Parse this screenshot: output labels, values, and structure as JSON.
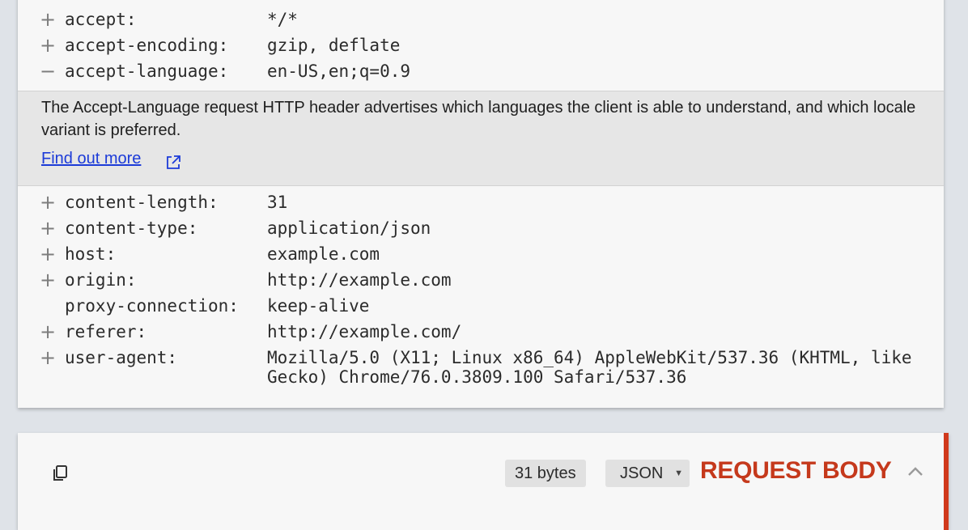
{
  "headers_top": [
    {
      "toggle": "+",
      "name": "accept:",
      "value": "*/*"
    },
    {
      "toggle": "+",
      "name": "accept-encoding:",
      "value": "gzip, deflate"
    },
    {
      "toggle": "−",
      "name": "accept-language:",
      "value": "en-US,en;q=0.9"
    }
  ],
  "doc": {
    "description": "The Accept-Language request HTTP header advertises which languages the client is able to understand, and which locale variant is preferred.",
    "link_label": "Find out more"
  },
  "headers_bottom": [
    {
      "toggle": "+",
      "name": "content-length:",
      "value": "31"
    },
    {
      "toggle": "+",
      "name": "content-type:",
      "value": "application/json"
    },
    {
      "toggle": "+",
      "name": "host:",
      "value": "example.com"
    },
    {
      "toggle": "+",
      "name": "origin:",
      "value": "http://example.com"
    },
    {
      "toggle": "",
      "name": "proxy-connection:",
      "value": "keep-alive"
    },
    {
      "toggle": "+",
      "name": "referer:",
      "value": "http://example.com/"
    },
    {
      "toggle": "+",
      "name": "user-agent:",
      "value": "Mozilla/5.0 (X11; Linux x86_64) AppleWebKit/537.36 (KHTML, like Gecko) Chrome/76.0.3809.100 Safari/537.36"
    }
  ],
  "request_body": {
    "size_label": "31 bytes",
    "format": "JSON",
    "title": "REQUEST BODY"
  },
  "colors": {
    "accent": "#c5391c",
    "link": "#1c3bd8"
  }
}
